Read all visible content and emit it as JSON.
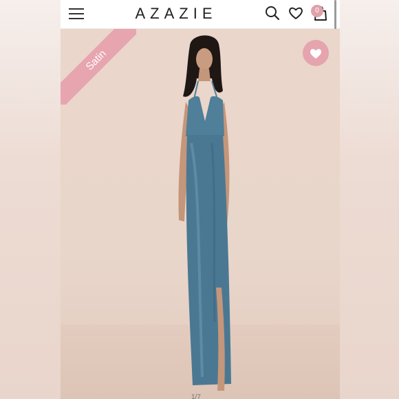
{
  "header": {
    "brand": "AZAZIE",
    "cart_count": "0",
    "icons": [
      "menu-icon",
      "search-icon",
      "heart-icon",
      "bag-icon"
    ]
  },
  "product": {
    "ribbon_label": "Satin",
    "pager": "1/7",
    "image_description": "model wearing a dusty blue satin maxi dress with slit",
    "colors": {
      "dress": "#4f7f99",
      "ribbon": "#e7a5b0",
      "wishlist": "#e5a4ae"
    }
  }
}
